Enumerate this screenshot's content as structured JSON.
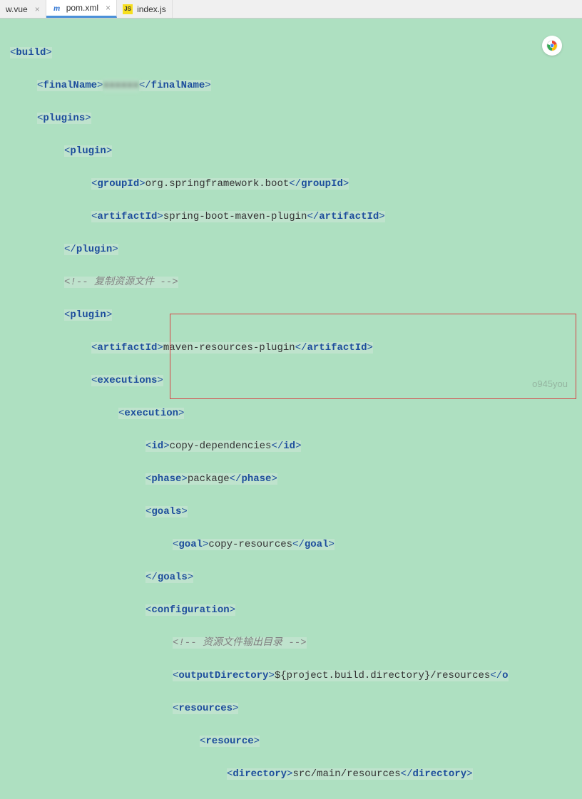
{
  "tabs": [
    {
      "label": "w.vue",
      "icon": "V"
    },
    {
      "label": "pom.xml",
      "icon": "m"
    },
    {
      "label": "index.js",
      "icon": "JS"
    }
  ],
  "code": {
    "build_open": "build",
    "finalName_open": "finalName",
    "finalName_val": "██████",
    "finalName_close": "finalName",
    "plugins_open": "plugins",
    "plugin_open": "plugin",
    "groupId_open": "groupId",
    "groupId_val": "org.springframework.boot",
    "groupId_close": "groupId",
    "artifactId_open": "artifactId",
    "artifactId1_val": "spring-boot-maven-plugin",
    "artifactId_close": "artifactId",
    "plugin_close": "plugin",
    "comment1": "<!-- 复制资源文件 -->",
    "artifactId2_val": "maven-resources-plugin",
    "executions_open": "executions",
    "execution_open": "execution",
    "id_open": "id",
    "id_val": "copy-dependencies",
    "id_close": "id",
    "phase_open": "phase",
    "phase_val": "package",
    "phase_close": "phase",
    "goals_open": "goals",
    "goal_open": "goal",
    "goal_val": "copy-resources",
    "goal_close": "goal",
    "goals_close": "goals",
    "configuration_open": "configuration",
    "comment2": "<!-- 资源文件输出目录 -->",
    "outputDirectory_open": "outputDirectory",
    "outputDirectory_val": "${project.build.directory}/resources",
    "outputDirectory_close": "o",
    "resources_open": "resources",
    "resource_open": "resource",
    "directory_open": "directory",
    "directory_val": "src/main/resources",
    "directory_close": "directory"
  },
  "watermark": "o945you"
}
